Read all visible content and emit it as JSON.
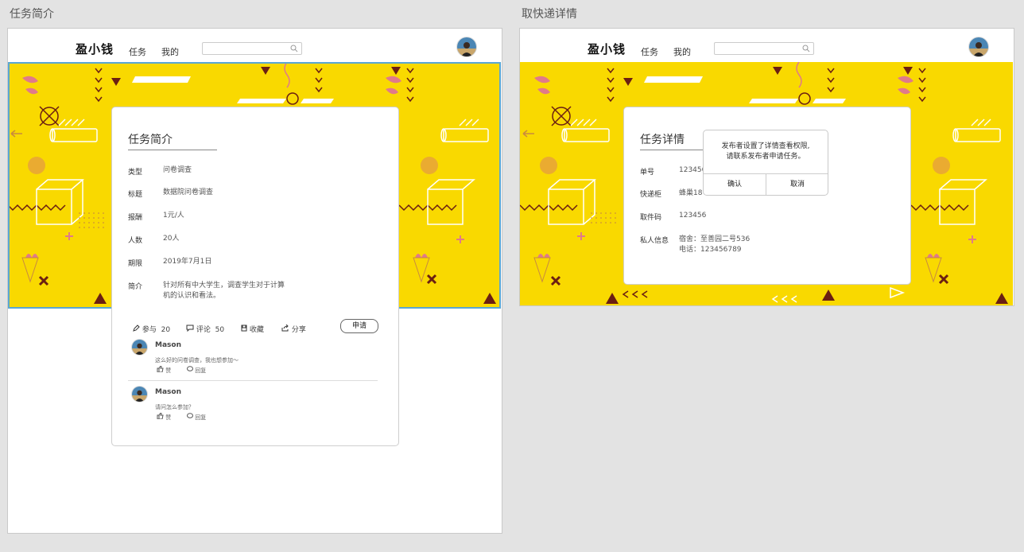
{
  "boards": {
    "left_title": "任务简介",
    "right_title": "取快递详情"
  },
  "nav": {
    "logo": "盈小钱",
    "links": [
      "任务",
      "我的"
    ],
    "search_placeholder": "",
    "search_icon": "search-icon",
    "avatar": "user-avatar"
  },
  "intro_card": {
    "title": "任务简介",
    "rows": [
      {
        "label": "类型",
        "value": "问卷调查"
      },
      {
        "label": "标题",
        "value": "数据院问卷调查"
      },
      {
        "label": "报酬",
        "value": "1元/人"
      },
      {
        "label": "人数",
        "value": "20人"
      },
      {
        "label": "期限",
        "value": "2019年7月1日"
      },
      {
        "label": "简介",
        "value_line1": "针对所有中大学生，调查学生对于计算",
        "value_line2": "机的认识和看法。"
      }
    ],
    "actions": {
      "join_label": "参与",
      "join_count": "20",
      "comment_label": "评论",
      "comment_count": "50",
      "favorite_label": "收藏",
      "share_label": "分享",
      "apply_label": "申请"
    },
    "comments": [
      {
        "name": "Mason",
        "text": "这么好的问卷调查，我也想参加～",
        "like": "赞",
        "reply": "回复"
      },
      {
        "name": "Mason",
        "text": "请问怎么参加？",
        "like": "赞",
        "reply": "回复"
      }
    ]
  },
  "detail_card": {
    "title": "任务详情",
    "rows": [
      {
        "label": "单号",
        "value": "123456"
      },
      {
        "label": "快递柜",
        "value": "蜂巢18"
      },
      {
        "label": "取件码",
        "value": "123456"
      },
      {
        "label": "私人信息",
        "value_line1": "宿舍：至善园二号536",
        "value_line2": "电话：123456789"
      }
    ],
    "modal": {
      "line1": "发布者设置了详情查看权限,",
      "line2": "请联系发布者申请任务。",
      "confirm": "确认",
      "cancel": "取消"
    }
  },
  "colors": {
    "banner": "#f9d900",
    "accent_dark": "#6b1f12",
    "accent_pink": "#e07a8a",
    "selection": "#5aa7d3"
  }
}
